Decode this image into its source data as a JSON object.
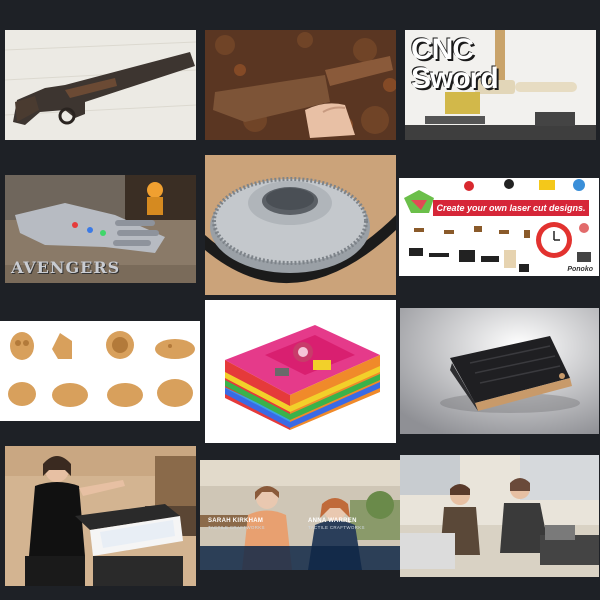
{
  "gallery": {
    "tiles": [
      {
        "name": "rusty-shotgun-image",
        "caption": ""
      },
      {
        "name": "rusty-knife-image",
        "caption": ""
      },
      {
        "name": "cnc-sword-image",
        "caption": "CNC Sword"
      },
      {
        "name": "infinity-gauntlet-image",
        "caption": "AVENGERS"
      },
      {
        "name": "timing-pulley-image",
        "caption": ""
      },
      {
        "name": "laser-cut-designs-image",
        "caption": "Create your own laser cut designs."
      },
      {
        "name": "bamboo-animal-cutouts-image",
        "caption": ""
      },
      {
        "name": "rainbow-pi-case-image",
        "caption": ""
      },
      {
        "name": "card-wallet-image",
        "caption": ""
      },
      {
        "name": "laser-cutter-woman-image",
        "caption": ""
      },
      {
        "name": "sarah-anna-interview-image",
        "caption": ""
      },
      {
        "name": "workshop-makers-image",
        "caption": ""
      }
    ],
    "cnc_line1": "CNC",
    "cnc_line2": "Sword",
    "avengers_logo": "AVENGERS",
    "laser_banner": "Create your own laser cut designs.",
    "ponoko_logo": "Ponoko",
    "interview": {
      "person1_name": "SARAH KIRKHAM",
      "person1_org": "TACTILE CRAFTWORKS",
      "person2_name": "ANNA WARREN",
      "person2_org": "TACTILE CRAFTWORKS"
    }
  },
  "colors": {
    "background": "#1e2126",
    "laser_banner": "#d62638"
  }
}
